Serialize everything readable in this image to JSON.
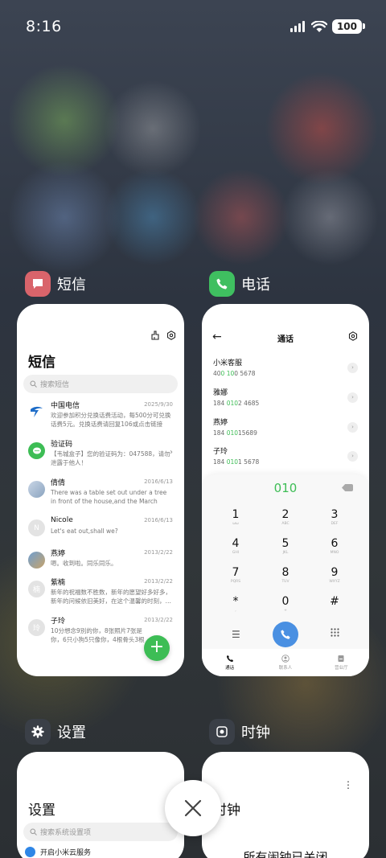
{
  "status_bar": {
    "time": "8:16",
    "battery": "100"
  },
  "colors": {
    "accent_green": "#3dbd55",
    "sms_icon": "#d9646b",
    "phone_icon": "#3fbf60",
    "call_blue": "#4a90e2"
  },
  "apps": {
    "sms": {
      "name": "短信",
      "title": "短信",
      "search_placeholder": "搜索短信",
      "threads": [
        {
          "name": "中国电信",
          "date": "2025/9/30",
          "text": "欢迎参加积分兑换话费活动，每500分可兑换话费5元。兑换话费请回复106或点击链接",
          "avatar": "telecom"
        },
        {
          "name": "验证码",
          "date": "",
          "text": "【韦城盒子】您的验证码为：047588，请勿泄露于他人！",
          "avatar": "chat"
        },
        {
          "name": "倩倩",
          "date": "2016/6/13",
          "text": "There was a table set out under a tree in front of the house,and the March Hare an…",
          "avatar": "photo"
        },
        {
          "name": "Nicole",
          "date": "2016/6/13",
          "text": "Let's eat out,shall we?",
          "avatar": "N"
        },
        {
          "name": "燕婷",
          "date": "2013/2/22",
          "text": "嗯。收到啦。同乐同乐。",
          "avatar": "photo2"
        },
        {
          "name": "紫楠",
          "date": "2013/2/22",
          "text": "新年的祝福数不胜数，新年的愿望好多好多，新年的问候依旧美好，在这个温馨的时刻，…",
          "avatar": "楠"
        },
        {
          "name": "子玲",
          "date": "2013/2/22",
          "text": "10分想念9別的你，8张照片7张是你，6只小狗5只像你，4根骨头3根白你，2爪看过你",
          "avatar": "玲"
        }
      ]
    },
    "phone": {
      "name": "电话",
      "title": "通话",
      "contacts": [
        {
          "name": "小米客服",
          "num_pre": "40",
          "num_hl": "0 10",
          "num_post": "0 5678"
        },
        {
          "name": "雅娜",
          "num_pre": "184 ",
          "num_hl": "010",
          "num_post": "2 4685"
        },
        {
          "name": "燕婷",
          "num_pre": "184 ",
          "num_hl": "010",
          "num_post": "15689"
        },
        {
          "name": "子玲",
          "num_pre": "184 ",
          "num_hl": "010",
          "num_post": "1 5678"
        }
      ],
      "dial_input": "010",
      "keys": [
        {
          "d": "1",
          "l": "ωω"
        },
        {
          "d": "2",
          "l": "ABC"
        },
        {
          "d": "3",
          "l": "DEF"
        },
        {
          "d": "4",
          "l": "GHI"
        },
        {
          "d": "5",
          "l": "JKL"
        },
        {
          "d": "6",
          "l": "MNO"
        },
        {
          "d": "7",
          "l": "PQRS"
        },
        {
          "d": "8",
          "l": "TUV"
        },
        {
          "d": "9",
          "l": "WXYZ"
        },
        {
          "d": "*",
          "l": ","
        },
        {
          "d": "0",
          "l": "+"
        },
        {
          "d": "#",
          "l": ""
        }
      ],
      "tabs": {
        "calls": "通话",
        "contacts": "联系人",
        "store": "营业厅"
      }
    },
    "settings": {
      "name": "设置",
      "title": "设置",
      "search_placeholder": "搜索系统设置项",
      "first_item": "开启小米云服务"
    },
    "clock": {
      "name": "时钟",
      "title": "时钟",
      "status": "所有闹钟已关闭"
    }
  }
}
